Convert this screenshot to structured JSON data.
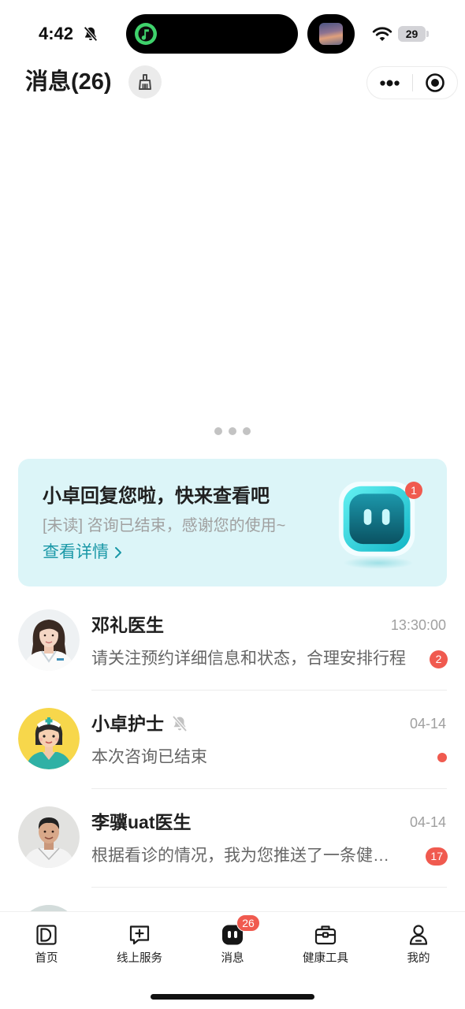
{
  "status_bar": {
    "time": "4:42",
    "battery": "29",
    "icons": [
      "bell-slash-icon",
      "music-app-icon",
      "album-art-thumbnail",
      "wifi-icon",
      "battery-icon"
    ]
  },
  "header": {
    "title": "消息(26)",
    "clean_icon": "broom-icon",
    "more_icon": "more-icon",
    "exit_icon": "target-icon"
  },
  "promo_card": {
    "title": "小卓回复您啦，快来查看吧",
    "subtitle": "[未读] 咨询已结束，感谢您的使用~",
    "link": "查看详情",
    "link_icon": "chevron-right-icon",
    "mascot_icon": "robot-mascot",
    "badge": "1"
  },
  "conversations": [
    {
      "name": "邓礼医生",
      "time": "13:30:00",
      "preview": "请关注预约详细信息和状态，合理安排行程",
      "badge": "2",
      "muted": false,
      "unread_dot": false
    },
    {
      "name": "小卓护士",
      "time": "04-14",
      "preview": "本次咨询已结束",
      "badge": null,
      "muted": true,
      "mute_icon": "bell-slash-icon",
      "unread_dot": true
    },
    {
      "name": "李骥uat医生",
      "time": "04-14",
      "preview": "根据看诊的情况，我为您推送了一条健…",
      "badge": "17",
      "muted": false,
      "unread_dot": false
    }
  ],
  "tab_bar": {
    "items": [
      {
        "label": "首页",
        "icon": "home-icon",
        "active": false
      },
      {
        "label": "线上服务",
        "icon": "chat-plus-icon",
        "active": false
      },
      {
        "label": "消息",
        "icon": "message-robot-icon",
        "active": true,
        "badge": "26"
      },
      {
        "label": "健康工具",
        "icon": "toolbox-icon",
        "active": false
      },
      {
        "label": "我的",
        "icon": "profile-icon",
        "active": false
      }
    ]
  },
  "colors": {
    "accent": "#1a98a7",
    "badge": "#f05a4f",
    "card_background": "#dcf5f8",
    "text_primary": "#1f1f1f",
    "text_secondary": "#a0a0a0"
  }
}
